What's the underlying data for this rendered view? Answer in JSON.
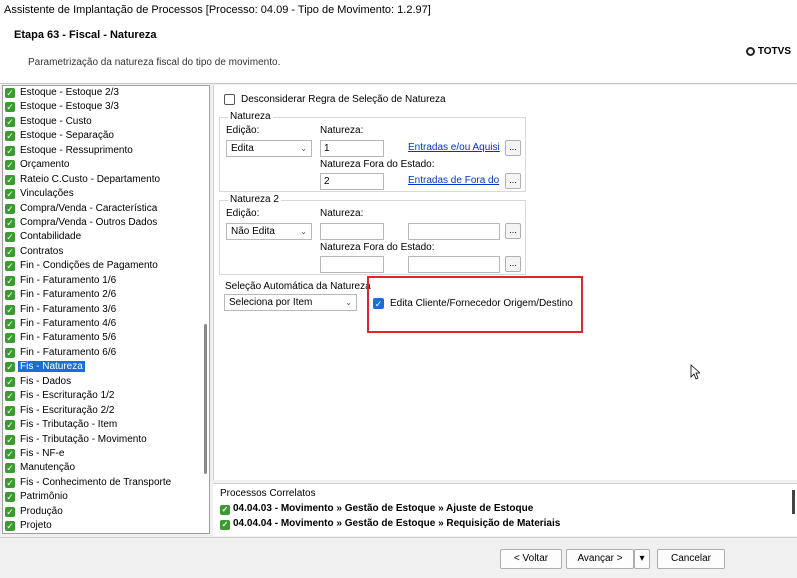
{
  "window": {
    "title": "Assistente de Implantação de Processos [Processo: 04.09 - Tipo de Movimento: 1.2.97]"
  },
  "header": {
    "step_title": "Etapa 63 - Fiscal - Natureza",
    "step_description": "Parametrização da natureza fiscal do tipo de movimento.",
    "logo_text": "TOTVS"
  },
  "sidebar": {
    "items": [
      {
        "label": "Estoque - Estoque 2/3"
      },
      {
        "label": "Estoque - Estoque 3/3"
      },
      {
        "label": "Estoque - Custo"
      },
      {
        "label": "Estoque - Separação"
      },
      {
        "label": "Estoque - Ressuprimento"
      },
      {
        "label": "Orçamento"
      },
      {
        "label": "Rateio C.Custo - Departamento"
      },
      {
        "label": "Vinculações"
      },
      {
        "label": "Compra/Venda - Característica"
      },
      {
        "label": "Compra/Venda - Outros Dados"
      },
      {
        "label": "Contabilidade"
      },
      {
        "label": "Contratos"
      },
      {
        "label": "Fin - Condições de Pagamento"
      },
      {
        "label": "Fin - Faturamento 1/6"
      },
      {
        "label": "Fin - Faturamento 2/6"
      },
      {
        "label": "Fin - Faturamento 3/6"
      },
      {
        "label": "Fin - Faturamento 4/6"
      },
      {
        "label": "Fin - Faturamento 5/6"
      },
      {
        "label": "Fin - Faturamento 6/6"
      },
      {
        "label": "Fis - Natureza"
      },
      {
        "label": "Fis - Dados"
      },
      {
        "label": "Fis - Escrituração 1/2"
      },
      {
        "label": "Fis - Escrituração 2/2"
      },
      {
        "label": "Fis - Tributação - Item"
      },
      {
        "label": "Fis - Tributação - Movimento"
      },
      {
        "label": "Fis - NF-e"
      },
      {
        "label": "Manutenção"
      },
      {
        "label": "Fis - Conhecimento de Transporte"
      },
      {
        "label": "Patrimônio"
      },
      {
        "label": "Produção"
      },
      {
        "label": "Projeto"
      }
    ],
    "selected_label": "Fis - Natureza"
  },
  "form": {
    "disregard_rule_label": "Desconsiderar Regra de Seleção de Natureza",
    "natureza": {
      "group_title": "Natureza",
      "edicao_label": "Edição:",
      "edicao_value": "Edita",
      "natureza_label": "Natureza:",
      "natureza_value": "1",
      "natureza_link": "Entradas e/ou Aquisi",
      "fora_estado_label": "Natureza Fora do Estado:",
      "fora_estado_value": "2",
      "fora_estado_link": "Entradas de Fora do",
      "dots_label": "..."
    },
    "natureza2": {
      "group_title": "Natureza 2",
      "edicao_label": "Edição:",
      "edicao_value": "Não Edita",
      "natureza_label": "Natureza:",
      "natureza_value": "",
      "fora_estado_label": "Natureza Fora do Estado:",
      "fora_estado_value": "",
      "dots_label": "..."
    },
    "auto_selection": {
      "label": "Seleção Automática da Natureza",
      "value": "Seleciona por Item"
    },
    "edit_client_label": "Edita Cliente/Fornecedor Origem/Destino",
    "edit_client_checked": true
  },
  "related": {
    "title": "Processos Correlatos",
    "items": [
      {
        "text": "04.04.03 - Movimento » Gestão de Estoque » Ajuste de Estoque"
      },
      {
        "text": "04.04.04 - Movimento » Gestão de Estoque » Requisição de Materiais"
      }
    ]
  },
  "footer": {
    "back_label": "< Voltar",
    "next_label": "Avançar >",
    "cancel_label": "Cancelar"
  },
  "colors": {
    "selection": "#1a6fd6",
    "highlight_border": "#e0262c",
    "check_green": "#3a9c2e",
    "link": "#0033cc"
  }
}
